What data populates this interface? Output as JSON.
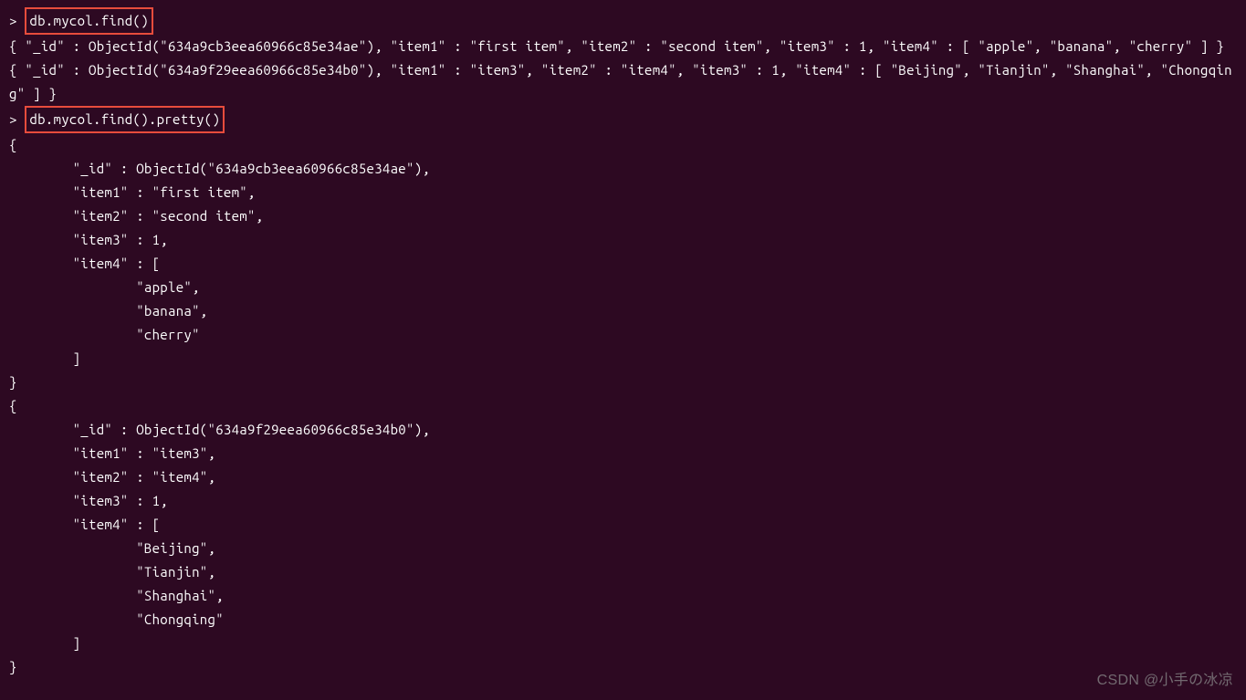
{
  "terminal": {
    "prompt": "> ",
    "command1": "db.mycol.find()",
    "output1_line1": "{ \"_id\" : ObjectId(\"634a9cb3eea60966c85e34ae\"), \"item1\" : \"first item\", \"item2\" : \"second item\", \"item3\" : 1, \"item4\" : [ \"apple\", \"banana\", \"cherry\" ] }",
    "output1_line2": "{ \"_id\" : ObjectId(\"634a9f29eea60966c85e34b0\"), \"item1\" : \"item3\", \"item2\" : \"item4\", \"item3\" : 1, \"item4\" : [ \"Beijing\", \"Tianjin\", \"Shanghai\", \"Chongqing\" ] }",
    "command2": "db.mycol.find().pretty()",
    "pretty_output": [
      "{",
      "        \"_id\" : ObjectId(\"634a9cb3eea60966c85e34ae\"),",
      "        \"item1\" : \"first item\",",
      "        \"item2\" : \"second item\",",
      "        \"item3\" : 1,",
      "        \"item4\" : [",
      "                \"apple\",",
      "                \"banana\",",
      "                \"cherry\"",
      "        ]",
      "}",
      "{",
      "        \"_id\" : ObjectId(\"634a9f29eea60966c85e34b0\"),",
      "        \"item1\" : \"item3\",",
      "        \"item2\" : \"item4\",",
      "        \"item3\" : 1,",
      "        \"item4\" : [",
      "                \"Beijing\",",
      "                \"Tianjin\",",
      "                \"Shanghai\",",
      "                \"Chongqing\"",
      "        ]",
      "}"
    ]
  },
  "watermark": "CSDN @小手の冰凉"
}
